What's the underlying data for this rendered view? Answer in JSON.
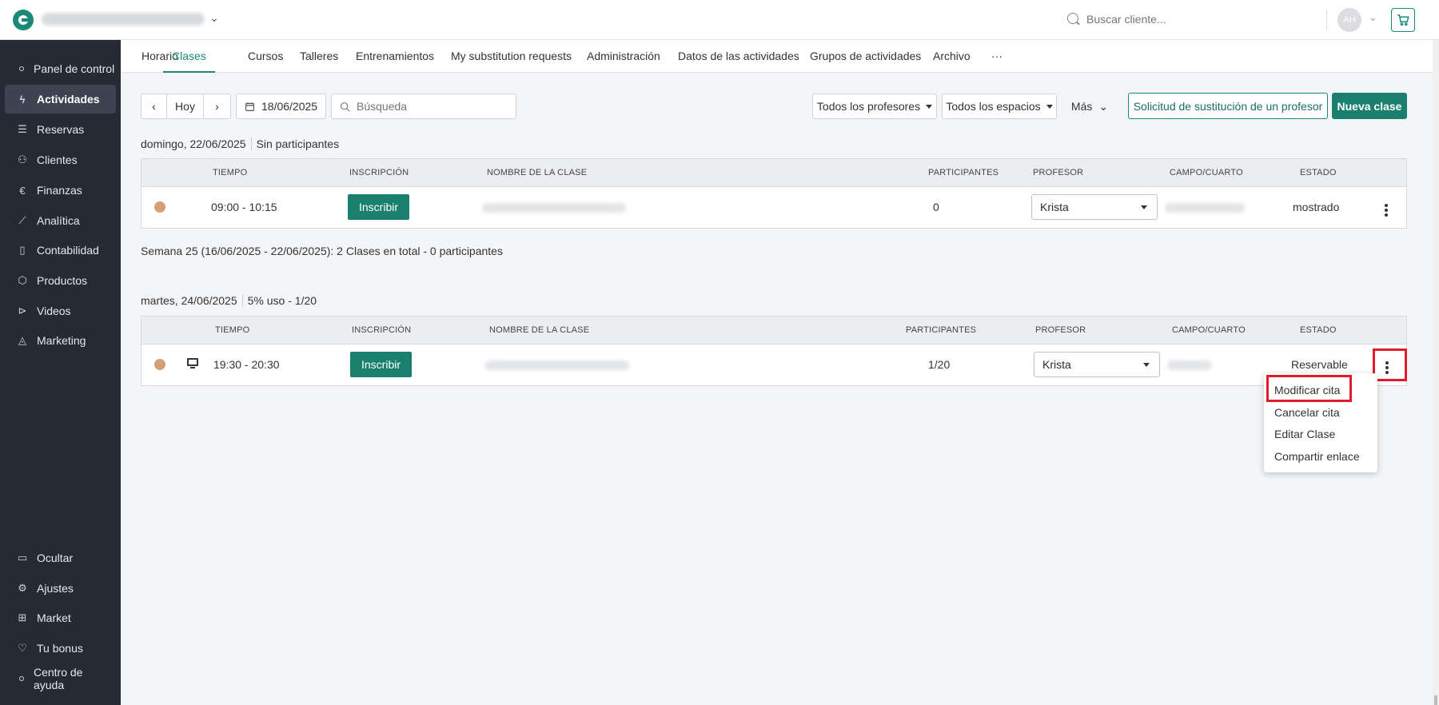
{
  "topbar": {
    "search_placeholder": "Buscar cliente...",
    "avatar_initials": "AH"
  },
  "sidebar": {
    "items": [
      {
        "label": "Panel de control",
        "icon": "dot-icon"
      },
      {
        "label": "Actividades",
        "icon": "bolt-icon",
        "active": true
      },
      {
        "label": "Reservas",
        "icon": "list-icon"
      },
      {
        "label": "Clientes",
        "icon": "user-icon"
      },
      {
        "label": "Finanzas",
        "icon": "euro-icon"
      },
      {
        "label": "Analítica",
        "icon": "chart-line-icon"
      },
      {
        "label": "Contabilidad",
        "icon": "clipboard-icon"
      },
      {
        "label": "Productos",
        "icon": "box-icon"
      },
      {
        "label": "Videos",
        "icon": "play-icon"
      },
      {
        "label": "Marketing",
        "icon": "megaphone-icon"
      }
    ],
    "bottom_items": [
      {
        "label": "Ocultar",
        "icon": "sidebar-collapse-icon"
      },
      {
        "label": "Ajustes",
        "icon": "gear-icon"
      },
      {
        "label": "Market",
        "icon": "plus-square-icon"
      },
      {
        "label": "Tu bonus",
        "icon": "heart-icon"
      },
      {
        "label": "Centro de ayuda",
        "icon": "dot-icon"
      }
    ]
  },
  "tabs": [
    {
      "label": "Horario"
    },
    {
      "label": "Clases",
      "active": true
    },
    {
      "label": "Cursos"
    },
    {
      "label": "Talleres"
    },
    {
      "label": "Entrenamientos"
    },
    {
      "label": "My substitution requests"
    },
    {
      "label": "Administración"
    },
    {
      "label": "Datos de las actividades"
    },
    {
      "label": "Grupos de actividades"
    },
    {
      "label": "Archivo"
    },
    {
      "label": "···"
    }
  ],
  "toolbar": {
    "today_label": "Hoy",
    "date_value": "18/06/2025",
    "search_placeholder": "Búsqueda",
    "teachers_filter": "Todos los profesores",
    "spaces_filter": "Todos los espacios",
    "more_label": "Más",
    "substitution_button": "Solicitud de sustitución de un profesor",
    "new_class_button": "Nueva clase"
  },
  "columns": {
    "time": "TIEMPO",
    "enrollment": "INSCRIPCIÓN",
    "class_name": "NOMBRE DE LA CLASE",
    "participants": "PARTICIPANTES",
    "teacher": "PROFESOR",
    "room": "CAMPO/CUARTO",
    "status": "ESTADO"
  },
  "sections": [
    {
      "date": "domingo, 22/06/2025",
      "info": "Sin participantes",
      "rows": [
        {
          "time": "09:00 - 10:15",
          "enroll_label": "Inscribir",
          "participants": "0",
          "teacher": "Krista",
          "status": "mostrado"
        }
      ]
    },
    {
      "date": "martes, 24/06/2025",
      "info": "5% uso - 1/20",
      "rows": [
        {
          "time": "19:30 - 20:30",
          "enroll_label": "Inscribir",
          "participants": "1/20",
          "teacher": "Krista",
          "status": "Reservable"
        }
      ]
    }
  ],
  "week_summary": {
    "week": "Semana 25",
    "text": "(16/06/2025 - 22/06/2025): 2 Clases en total  - 0 participantes"
  },
  "row_menu": {
    "items": [
      "Modificar cita",
      "Cancelar cita",
      "Editar Clase",
      "Compartir enlace"
    ]
  },
  "colors": {
    "accent": "#1a7f6d",
    "sidebar_bg": "#252a35",
    "highlight": "#e11d2a",
    "status_dot": "#d4a07a"
  }
}
